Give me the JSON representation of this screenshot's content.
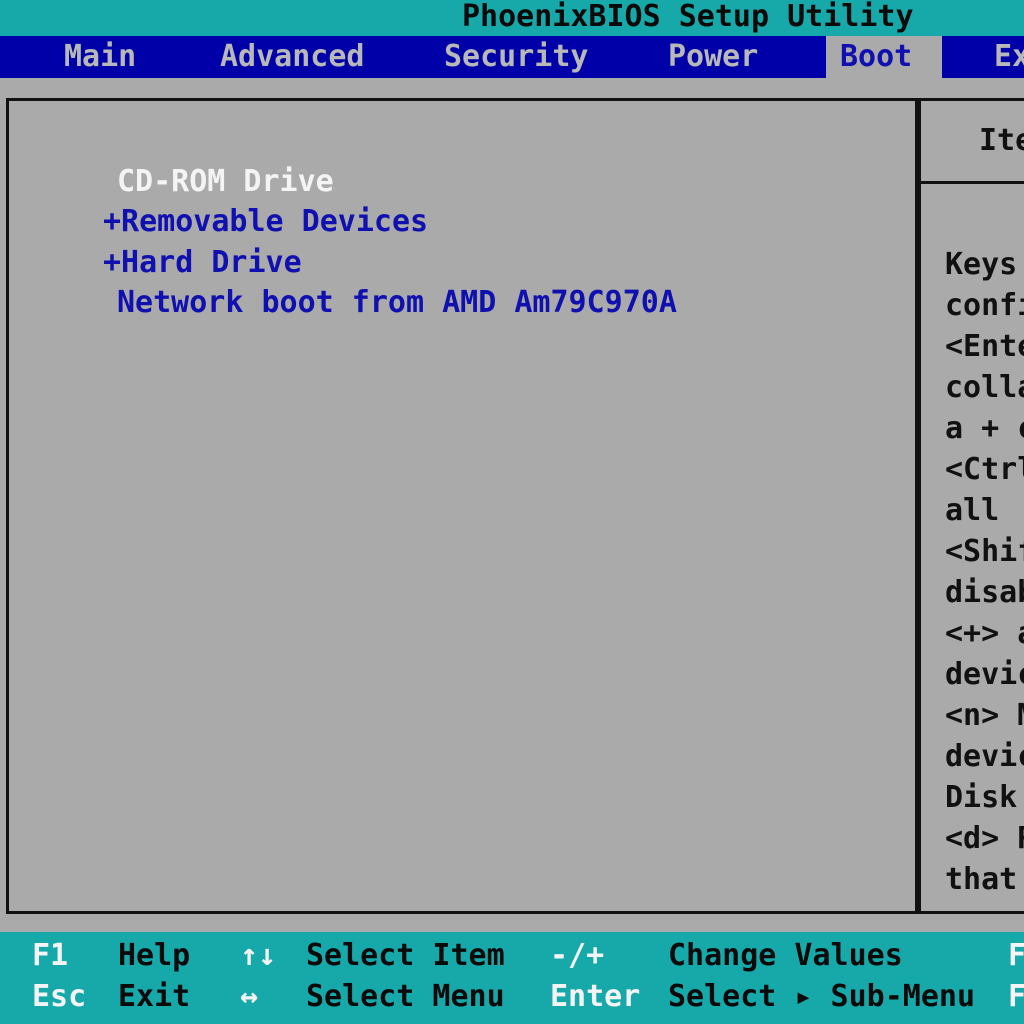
{
  "app": {
    "title": "PhoenixBIOS Setup Utility"
  },
  "menu": {
    "tabs": [
      {
        "label": "Main"
      },
      {
        "label": "Advanced"
      },
      {
        "label": "Security"
      },
      {
        "label": "Power"
      },
      {
        "label": "Boot",
        "active": true
      },
      {
        "label": "Ex"
      }
    ]
  },
  "boot": {
    "items": [
      {
        "label": "CD-ROM Drive",
        "selected": true
      },
      {
        "label": "+Removable Devices"
      },
      {
        "label": "+Hard Drive"
      },
      {
        "label": "Network boot from AMD Am79C970A"
      }
    ]
  },
  "help": {
    "title": "Ite",
    "lines": [
      "Keys",
      "confi",
      "<Ente",
      "colla",
      "a + c",
      "<Ctrl",
      "all",
      "<Shif",
      "disab",
      "<+> a",
      "devic",
      "<n> M",
      "devic",
      "Disk",
      "<d> R",
      "that"
    ]
  },
  "footer": {
    "row1": {
      "k1": "F1",
      "d1": "Help",
      "k2": "↑↓",
      "d2": "Select Item",
      "k3": "-/+",
      "d3": "Change Values",
      "k4": "F"
    },
    "row2": {
      "k1": "Esc",
      "d1": "Exit",
      "k2": "↔",
      "d2": "Select Menu",
      "k3": "Enter",
      "d3": "Select ▸ Sub-Menu",
      "k4": "F"
    }
  },
  "colors": {
    "menu_bar": "#0000a8",
    "title_bar": "#17a9a9",
    "panel": "#aaaaaa",
    "item_text": "#1010b0",
    "selected_text": "#f4f4f4"
  }
}
